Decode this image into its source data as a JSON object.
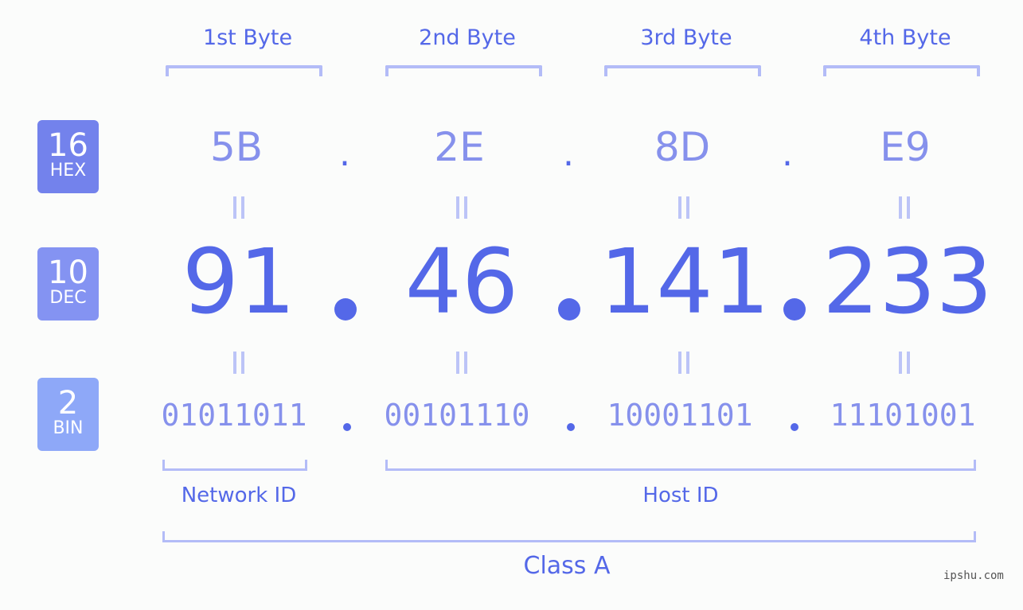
{
  "byte_headers": [
    "1st Byte",
    "2nd Byte",
    "3rd Byte",
    "4th Byte"
  ],
  "badges": {
    "hex": {
      "num": "16",
      "label": "HEX",
      "color": "#7382ec"
    },
    "dec": {
      "num": "10",
      "label": "DEC",
      "color": "#8493f2"
    },
    "bin": {
      "num": "2",
      "label": "BIN",
      "color": "#8ea8f8"
    }
  },
  "hex": [
    "5B",
    "2E",
    "8D",
    "E9"
  ],
  "dec": [
    "91",
    "46",
    "141",
    "233"
  ],
  "bin": [
    "01011011",
    "00101110",
    "10001101",
    "11101001"
  ],
  "separator": ".",
  "labels": {
    "network": "Network ID",
    "host": "Host ID",
    "class": "Class A"
  },
  "watermark": "ipshu.com",
  "colors": {
    "accent": "#5468e8",
    "light": "#8691ec",
    "bracket": "#b3bcf7"
  }
}
